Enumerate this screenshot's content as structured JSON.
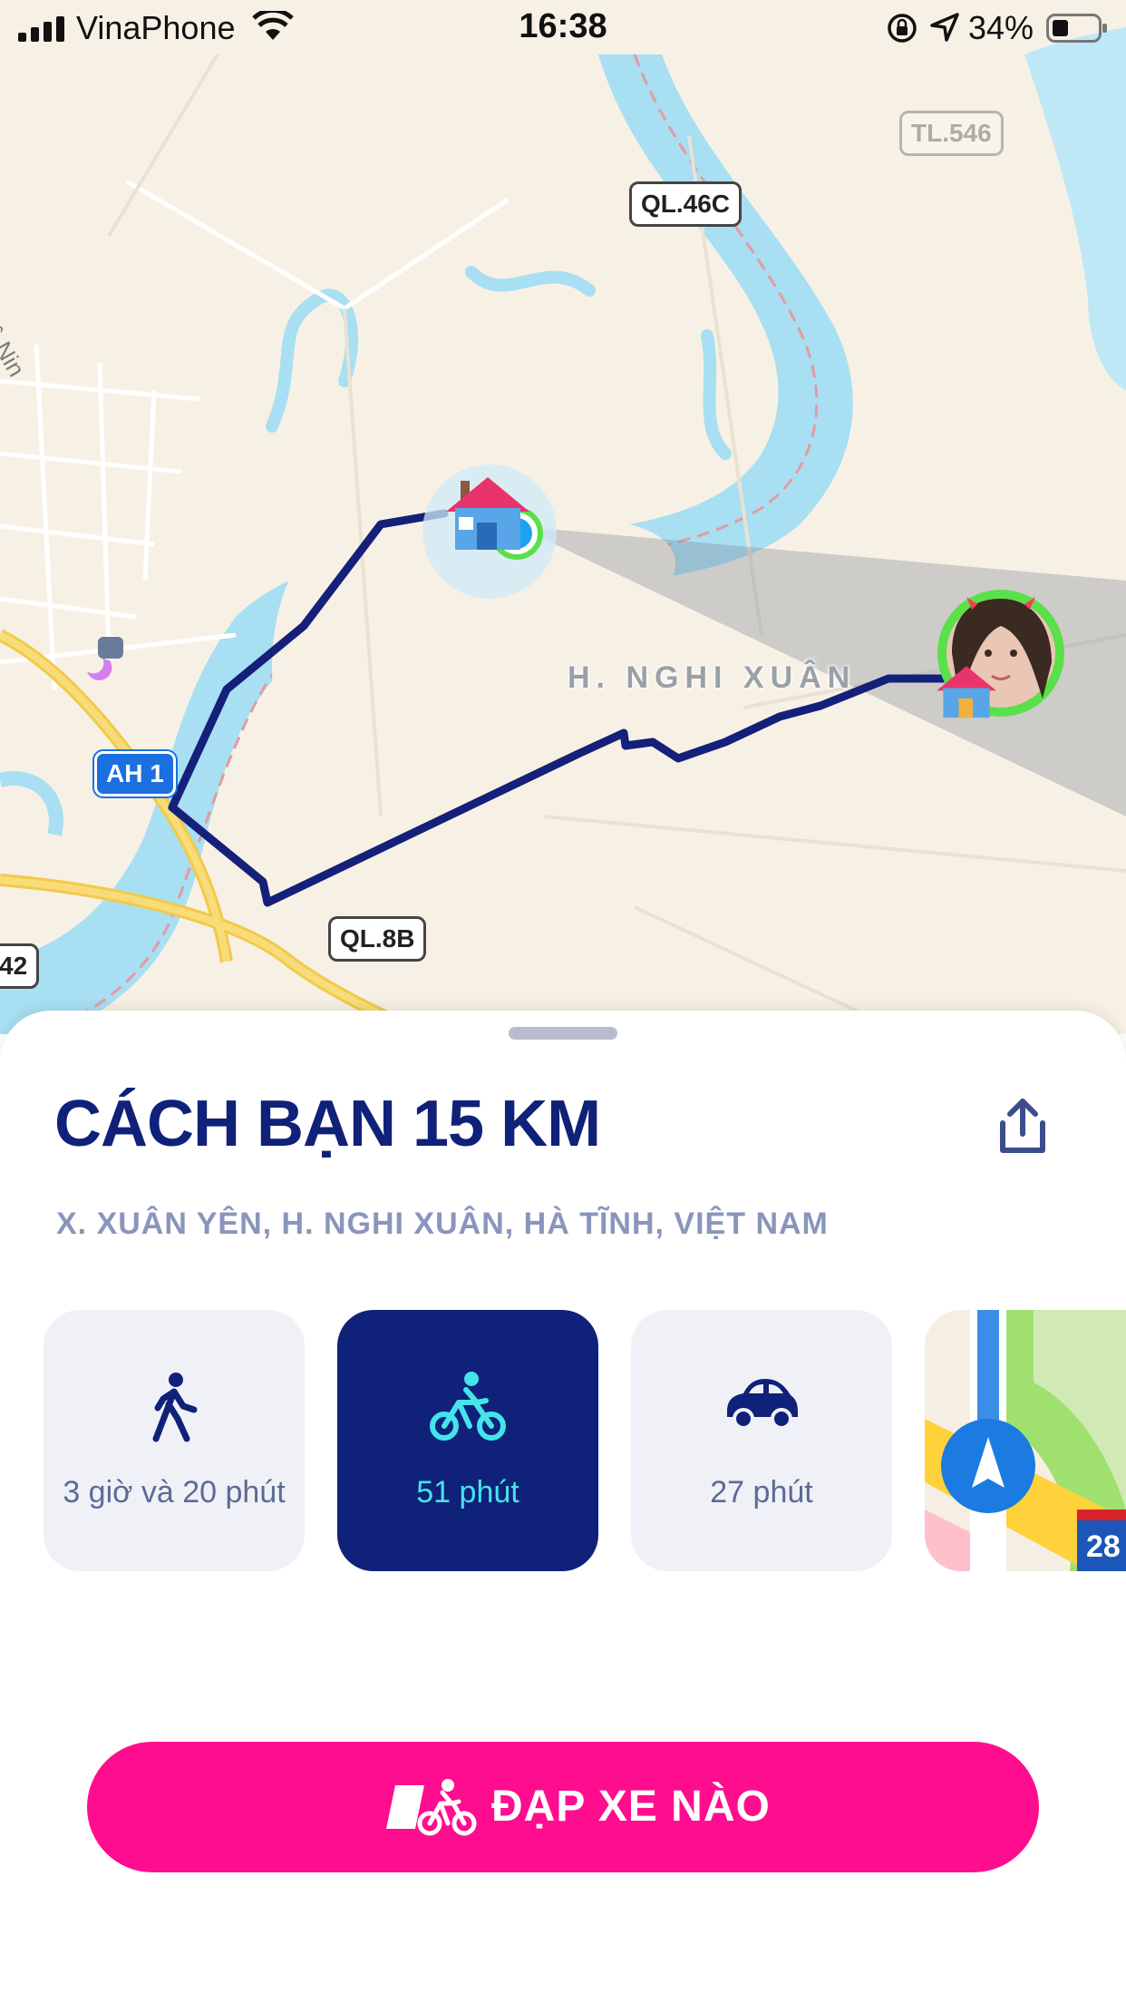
{
  "status_bar": {
    "carrier": "VinaPhone",
    "time": "16:38",
    "battery_percent": "34%"
  },
  "map": {
    "road_shields": {
      "ql46c": "QL.46C",
      "tl546": "TL.546",
      "ah1": "AH 1",
      "ql8b": "QL.8B",
      "partial": "42"
    },
    "district_label": "H. NGHI XUÂN",
    "partial_street": "Lê Nin",
    "colors": {
      "route": "#14207a",
      "water": "#a8dff3",
      "land": "#f7f1e5",
      "user_dot": "#1da1f2",
      "friend_ring": "#5ae04a"
    }
  },
  "sheet": {
    "title": "CÁCH BẠN 15 KM",
    "address": "X. XUÂN YÊN, H. NGHI XUÂN, HÀ TĨNH, VIỆT NAM",
    "modes": [
      {
        "icon": "walk-icon",
        "label": "3 giờ và 20 phút",
        "selected": false
      },
      {
        "icon": "bike-icon",
        "label": "51 phút",
        "selected": true
      },
      {
        "icon": "car-icon",
        "label": "27 phút",
        "selected": false
      }
    ],
    "cta_label": "ĐẠP XE NÀO",
    "colors": {
      "title": "#0f2178",
      "cta": "#ff0d8f",
      "active_tile": "#0f2178",
      "active_text": "#44e4ea"
    }
  }
}
